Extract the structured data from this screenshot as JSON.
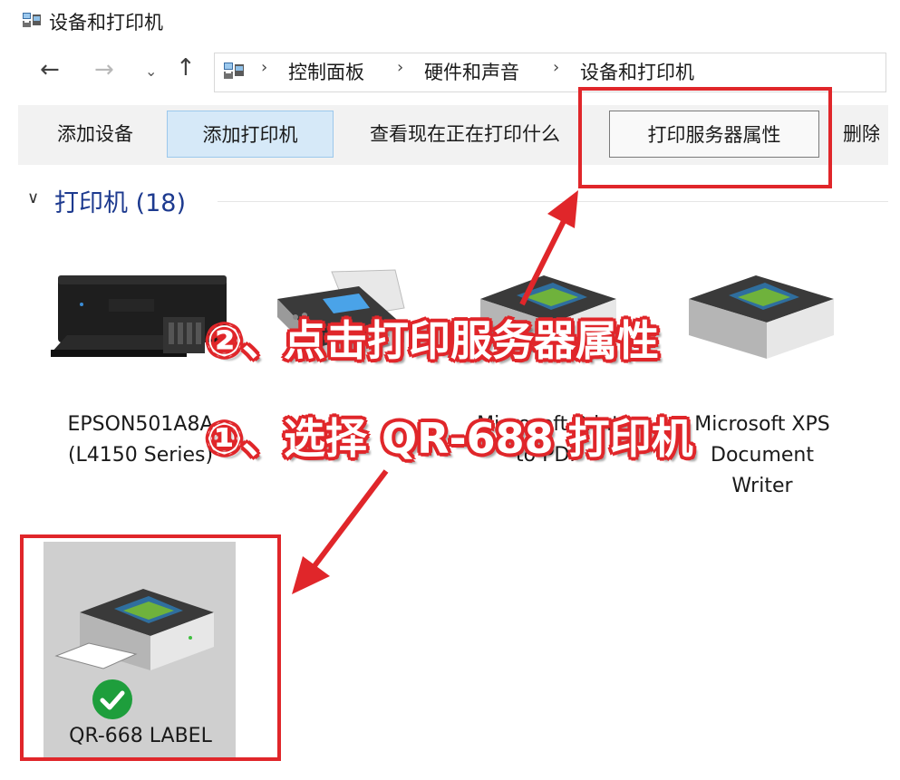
{
  "window": {
    "title": "设备和打印机"
  },
  "nav": {
    "back": "←",
    "forward": "→",
    "recent": "⌄",
    "up": "↑"
  },
  "breadcrumb": {
    "items": [
      "控制面板",
      "硬件和声音",
      "设备和打印机"
    ],
    "separator": "›"
  },
  "toolbar": {
    "add_device": "添加设备",
    "add_printer": "添加打印机",
    "see_printing": "查看现在正在打印什么",
    "print_server_props": "打印服务器属性",
    "delete": "删除"
  },
  "group": {
    "chevron": "∨",
    "title": "打印机 (18)"
  },
  "devices": [
    {
      "label_line1": "EPSON501A8A",
      "label_line2": "(L4150 Series)",
      "icon": "inkjet-printer-icon"
    },
    {
      "label_line1": "",
      "label_line2": "",
      "icon": "fax-icon"
    },
    {
      "label_line1": "Microsoft Print",
      "label_line2": "to PDF",
      "icon": "printer-icon"
    },
    {
      "label_line1": "Microsoft XPS",
      "label_line2": "Document",
      "label_line3": "Writer",
      "icon": "printer-icon"
    },
    {
      "label_line1": "QR-668 LABEL",
      "icon": "printer-icon",
      "status": "default-check-icon"
    }
  ],
  "annotations": {
    "step2": "②、点击打印服务器属性",
    "step1": "①、选择 QR-688 打印机"
  },
  "colors": {
    "highlight": "#e0262a",
    "group_title": "#1d3a8f",
    "selected_button": "#d6e9f8"
  }
}
